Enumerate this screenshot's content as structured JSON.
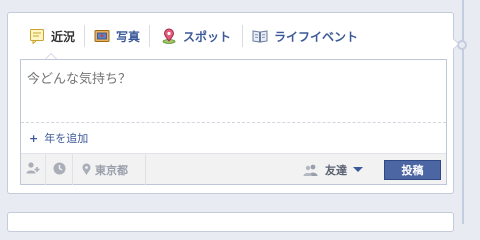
{
  "composer": {
    "tabs": [
      {
        "label": "近況",
        "icon": "status-icon",
        "active": true
      },
      {
        "label": "写真",
        "icon": "photo-icon",
        "active": false
      },
      {
        "label": "スポット",
        "icon": "place-pin-icon",
        "active": false
      },
      {
        "label": "ライフイベント",
        "icon": "life-event-book-icon",
        "active": false
      }
    ],
    "input": {
      "placeholder": "今どんな気持ち？",
      "value": ""
    },
    "add_year_label": "年を追加",
    "bottom_bar": {
      "tag_friends_icon": "add-friend-icon",
      "time_icon": "clock-icon",
      "location_icon": "location-pin-icon",
      "location_label": "東京都",
      "audience_icon": "friends-icon",
      "audience_label": "友達",
      "post_label": "投稿"
    }
  },
  "colors": {
    "background": "#e9ebf2",
    "link_blue": "#3b5998",
    "post_button": "#4c66a4",
    "border": "#c4cbda"
  }
}
